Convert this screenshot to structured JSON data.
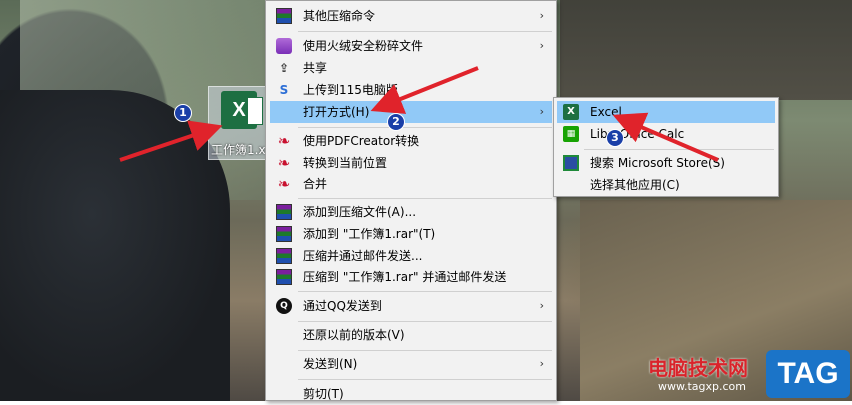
{
  "file": {
    "name": "工作簿1.x",
    "icon": "excel-file-icon"
  },
  "menu": {
    "items": [
      {
        "label": "其他压缩命令",
        "icon": "archive-icon",
        "submenu": true
      },
      {
        "label": "使用火绒安全粉碎文件",
        "icon": "huorong-shred-icon",
        "submenu": true
      },
      {
        "label": "共享",
        "icon": "share-icon"
      },
      {
        "label": "上传到115电脑版",
        "icon": "upload-115-icon"
      },
      {
        "label": "打开方式(H)",
        "icon": "",
        "submenu": true,
        "highlighted": true
      },
      {
        "label": "使用PDFCreator转换",
        "icon": "pdfcreator-icon"
      },
      {
        "label": "转换到当前位置",
        "icon": "pdfcreator-icon"
      },
      {
        "label": "合并",
        "icon": "pdfcreator-icon"
      },
      {
        "label": "添加到压缩文件(A)...",
        "icon": "winrar-icon"
      },
      {
        "label": "添加到 \"工作簿1.rar\"(T)",
        "icon": "winrar-icon"
      },
      {
        "label": "压缩并通过邮件发送...",
        "icon": "winrar-icon"
      },
      {
        "label": "压缩到 \"工作簿1.rar\" 并通过邮件发送",
        "icon": "winrar-icon"
      },
      {
        "label": "通过QQ发送到",
        "icon": "qq-icon",
        "submenu": true
      },
      {
        "label": "还原以前的版本(V)",
        "icon": ""
      },
      {
        "label": "发送到(N)",
        "icon": "",
        "submenu": true
      },
      {
        "label": "剪切(T)",
        "icon": ""
      }
    ]
  },
  "submenu": {
    "items": [
      {
        "label": "Excel",
        "icon": "excel-icon",
        "highlighted": true
      },
      {
        "label": "LibreOffice Calc",
        "icon": "libreoffice-calc-icon"
      },
      {
        "label": "搜索 Microsoft Store(S)",
        "icon": "microsoft-store-icon"
      },
      {
        "label": "选择其他应用(C)",
        "icon": ""
      }
    ]
  },
  "callouts": [
    "1",
    "2",
    "3"
  ],
  "watermark": {
    "text": "电脑技术网",
    "url": "www.tagxp.com",
    "tag": "TAG"
  },
  "colors": {
    "highlight": "#91c9f7",
    "arrow": "#e0232b",
    "callout": "#1a3fa8"
  }
}
